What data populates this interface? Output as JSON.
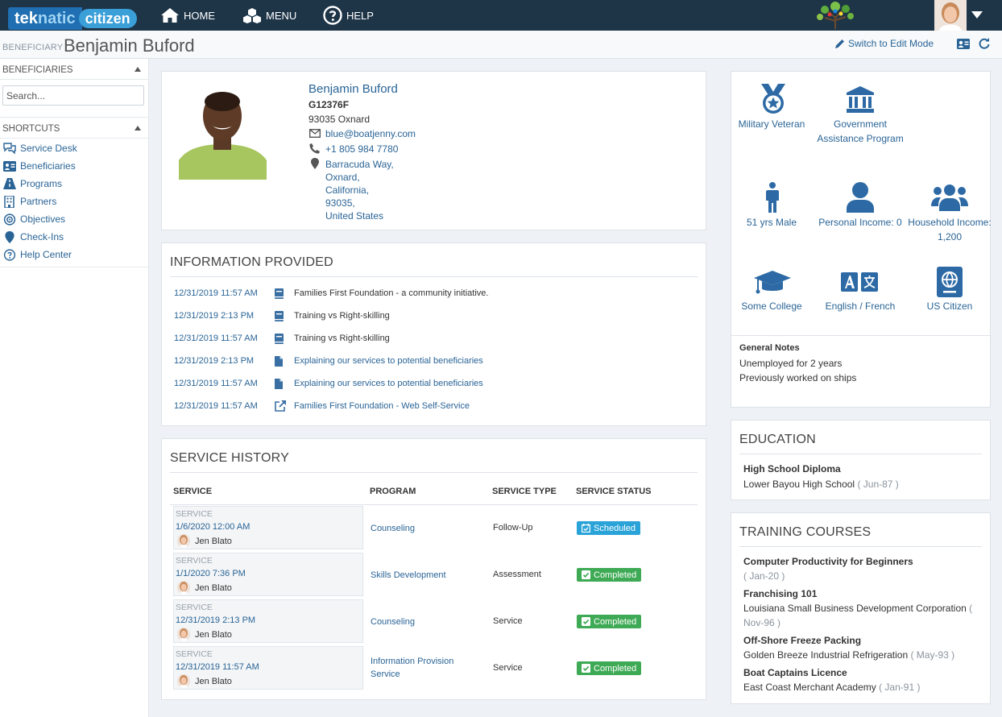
{
  "topbar": {
    "logo_part1": "tek",
    "logo_part2": "natic",
    "logo_part3": "citizen",
    "nav": [
      {
        "label": "HOME",
        "icon": "home-icon"
      },
      {
        "label": "MENU",
        "icon": "cubes-icon"
      },
      {
        "label": "HELP",
        "icon": "question-circle-icon"
      }
    ]
  },
  "subheader": {
    "label": "BENEFICIARY",
    "name": "Benjamin Buford",
    "edit_mode": "Switch to Edit Mode"
  },
  "sidebar": {
    "beneficiaries_header": "BENEFICIARIES",
    "search_placeholder": "Search...",
    "shortcuts_header": "SHORTCUTS",
    "shortcuts": [
      {
        "label": "Service Desk",
        "icon": "comments-icon"
      },
      {
        "label": "Beneficiaries",
        "icon": "id-card-icon"
      },
      {
        "label": "Programs",
        "icon": "road-icon"
      },
      {
        "label": "Partners",
        "icon": "building-icon"
      },
      {
        "label": "Objectives",
        "icon": "target-icon"
      },
      {
        "label": "Check-Ins",
        "icon": "map-marker-icon"
      },
      {
        "label": "Help Center",
        "icon": "question-circle-icon"
      }
    ]
  },
  "profile": {
    "name": "Benjamin Buford",
    "id": "G12376F",
    "zip_city": "93035 Oxnard",
    "email": "blue@boatjenny.com",
    "phone": "+1 805 984 7780",
    "address": [
      "Barracuda Way,",
      "Oxnard,",
      "California,",
      "93035,",
      "United States"
    ]
  },
  "info_provided": {
    "title": "INFORMATION PROVIDED",
    "rows": [
      {
        "date": "12/31/2019 11:57 AM",
        "icon": "book-icon",
        "text": "Families First Foundation - a community initiative.",
        "link": false
      },
      {
        "date": "12/31/2019 2:13 PM",
        "icon": "book-icon",
        "text": "Training vs Right-skilling",
        "link": false
      },
      {
        "date": "12/31/2019 11:57 AM",
        "icon": "book-icon",
        "text": "Training vs Right-skilling",
        "link": false
      },
      {
        "date": "12/31/2019 2:13 PM",
        "icon": "file-icon",
        "text": "Explaining our services to potential beneficiaries",
        "link": true
      },
      {
        "date": "12/31/2019 11:57 AM",
        "icon": "file-icon",
        "text": "Explaining our services to potential beneficiaries",
        "link": true
      },
      {
        "date": "12/31/2019 11:57 AM",
        "icon": "external-link-icon",
        "text": "Families First Foundation - Web Self-Service",
        "link": true
      }
    ]
  },
  "service_history": {
    "title": "SERVICE HISTORY",
    "headers": [
      "SERVICE",
      "PROGRAM",
      "SERVICE TYPE",
      "SERVICE STATUS"
    ],
    "rows": [
      {
        "label": "SERVICE",
        "date": "1/6/2020 12:00 AM",
        "staff": "Jen Blato",
        "program": "Counseling",
        "type": "Follow-Up",
        "status": "Scheduled"
      },
      {
        "label": "SERVICE",
        "date": "1/1/2020 7:36 PM",
        "staff": "Jen Blato",
        "program": "Skills Development",
        "type": "Assessment",
        "status": "Completed"
      },
      {
        "label": "SERVICE",
        "date": "12/31/2019 2:13 PM",
        "staff": "Jen Blato",
        "program": "Counseling",
        "type": "Service",
        "status": "Completed"
      },
      {
        "label": "SERVICE",
        "date": "12/31/2019 11:57 AM",
        "staff": "Jen Blato",
        "program": "Information Provision Service",
        "type": "Service",
        "status": "Completed"
      }
    ],
    "status_colors": {
      "Scheduled": "#2aa3d8",
      "Completed": "#3faa55"
    }
  },
  "attributes": {
    "military": "Military Veteran",
    "government": "Government Assistance Program",
    "age_gender": "51 yrs Male",
    "personal_income": "Personal Income: 0",
    "household_income": "Household Income: 1,200",
    "education": "Some College",
    "languages": "English / French",
    "citizenship": "US Citizen",
    "notes_title": "General Notes",
    "notes": [
      "Unemployed for 2 years",
      "Previously worked on ships"
    ]
  },
  "education": {
    "title": "EDUCATION",
    "degree": "High School Diploma",
    "school": "Lower Bayou High School",
    "date": "( Jun-87 )"
  },
  "training": {
    "title": "TRAINING COURSES",
    "courses": [
      {
        "name": "Computer Productivity for Beginners",
        "org": "",
        "date": "( Jan-20 )"
      },
      {
        "name": "Franchising 101",
        "org": "Louisiana Small Business Development Corporation",
        "date": "( Nov-96 )"
      },
      {
        "name": "Off-Shore Freeze Packing",
        "org": "Golden Breeze Industrial Refrigeration",
        "date": "( May-93 )"
      },
      {
        "name": "Boat Captains Licence",
        "org": "East Coast Merchant Academy",
        "date": "( Jan-91 )"
      }
    ]
  },
  "colors": {
    "topbar": "#1e3447",
    "link": "#2a6496",
    "icon_blue": "#2d6aa5"
  }
}
